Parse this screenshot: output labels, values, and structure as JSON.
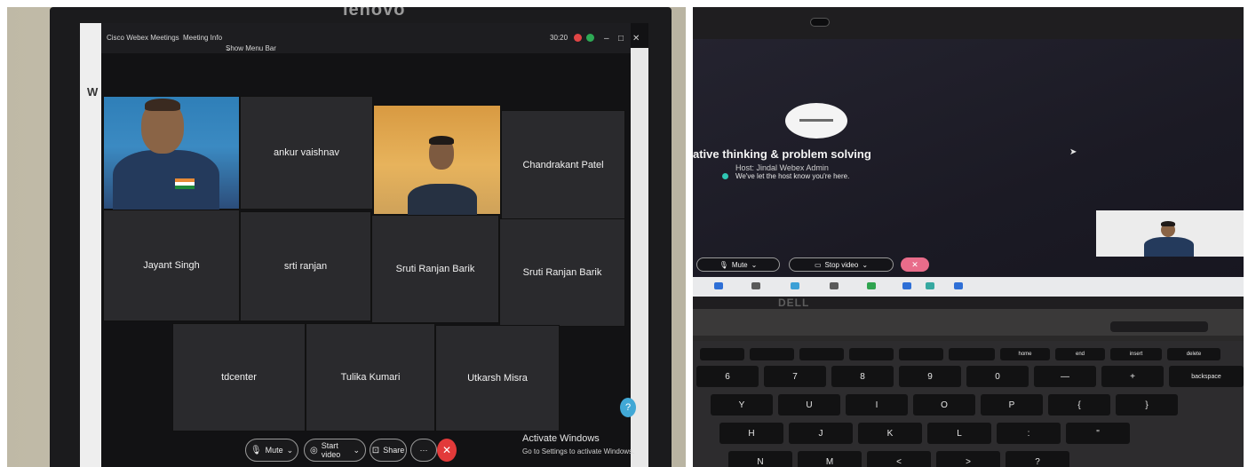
{
  "left_screen": {
    "brand": "lenovo",
    "app_title": "Cisco Webex Meetings",
    "meeting_info": "Meeting Info",
    "show_menu_bar": "Show Menu Bar",
    "timer": "30:20",
    "browser_letter": "W",
    "participants": [
      {
        "name": "",
        "has_video": true
      },
      {
        "name": "ankur vaishnav",
        "has_video": false
      },
      {
        "name": "",
        "has_video": true
      },
      {
        "name": "Chandrakant Patel",
        "has_video": false
      },
      {
        "name": "Jayant Singh",
        "has_video": false
      },
      {
        "name": "srti ranjan",
        "has_video": false
      },
      {
        "name": "Sruti Ranjan Barik",
        "has_video": false
      },
      {
        "name": "Sruti Ranjan Barik",
        "has_video": false
      },
      {
        "name": "tdcenter",
        "has_video": false
      },
      {
        "name": "Tulika Kumari",
        "has_video": false
      },
      {
        "name": "Utkarsh Misra",
        "has_video": false
      }
    ],
    "controls": {
      "mute": "Mute",
      "start_video": "Start video",
      "share": "Share"
    },
    "help": "?",
    "activate_title": "Activate Windows",
    "activate_sub": "Go to Settings to activate Windows."
  },
  "right_screen": {
    "meeting_title": "ative thinking & problem solving",
    "host": "Host: Jindal Webex Admin",
    "notice": "We've let the host know you're here.",
    "controls": {
      "mute": "Mute",
      "stop_video": "Stop video"
    },
    "laptop_brand": "DELL",
    "keys_top": [
      "home",
      "end",
      "insert",
      "delete"
    ],
    "keys_row1": [
      "6",
      "7",
      "8",
      "9",
      "0",
      "—",
      "+",
      "backspace"
    ],
    "keys_row2": [
      "Y",
      "U",
      "I",
      "O",
      "P",
      "{",
      "}"
    ],
    "keys_row3": [
      "H",
      "J",
      "K",
      "L",
      ":",
      "\""
    ],
    "keys_row4": [
      "N",
      "M",
      "<",
      ">",
      "?"
    ]
  },
  "colors": {
    "end_call": "#e23a3a",
    "leave": "#e86c8a",
    "notice_dot": "#2fc7b4",
    "help": "#41a8d6"
  }
}
